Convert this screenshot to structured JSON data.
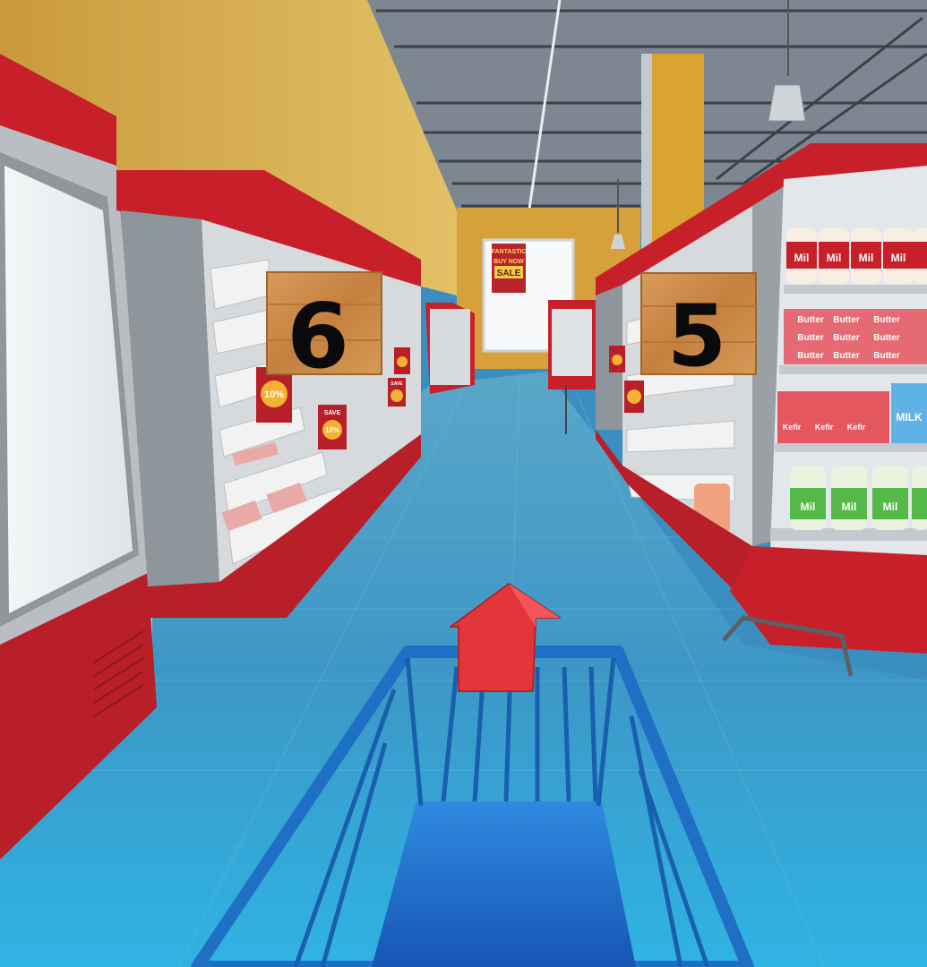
{
  "scene": {
    "aisle_signs": [
      {
        "number": "6"
      },
      {
        "number": "5"
      }
    ],
    "back_wall_banner": {
      "line1": "FANTASTIC",
      "line2": "BUY NOW",
      "line3": "SALE"
    },
    "promo_tag": {
      "save": "SAVE",
      "percent": "10%"
    },
    "products": {
      "milk_label": "Mil",
      "butter_label": "Butter",
      "kefir_label": "Kefir",
      "milk_carton_label": "MILK"
    },
    "direction_arrow": "forward",
    "colors": {
      "floor": "#3f9ccb",
      "shelf_red": "#c8202b",
      "shelf_gray": "#9aa0a6",
      "cart_blue": "#1f6fc4",
      "arrow_red": "#e2363b",
      "wall_yellow": "#d9a431",
      "sign_wood": "#c7894a"
    }
  }
}
